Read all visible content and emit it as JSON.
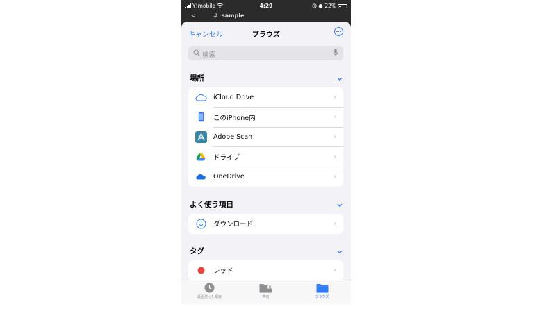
{
  "status_bar": {
    "carrier": "Y!mobile",
    "time": "4:29",
    "battery": "22%"
  },
  "behind_header": {
    "back": "<",
    "hash": "#",
    "title": "sample"
  },
  "nav": {
    "cancel_label": "キャンセル",
    "title": "ブラウズ",
    "more_icon": "ellipsis-circle-icon"
  },
  "search": {
    "placeholder": "検索"
  },
  "sections": {
    "locations": {
      "header": "場所",
      "items": [
        {
          "label": "iCloud Drive",
          "icon": "icloud-icon"
        },
        {
          "label": "このiPhone内",
          "icon": "iphone-icon"
        },
        {
          "label": "Adobe Scan",
          "icon": "adobe-scan-icon"
        },
        {
          "label": "ドライブ",
          "icon": "google-drive-icon"
        },
        {
          "label": "OneDrive",
          "icon": "onedrive-icon"
        }
      ]
    },
    "favorites": {
      "header": "よく使う項目",
      "items": [
        {
          "label": "ダウンロード",
          "icon": "download-circle-icon"
        }
      ]
    },
    "tags": {
      "header": "タグ",
      "items": [
        {
          "label": "レッド",
          "icon": "red-tag-dot-icon",
          "color": "#e8453c"
        }
      ]
    }
  },
  "tabbar": {
    "tabs": [
      {
        "label": "最近使った項目",
        "icon": "clock-icon",
        "active": false
      },
      {
        "label": "共有",
        "icon": "shared-folder-icon",
        "active": false
      },
      {
        "label": "ブラウズ",
        "icon": "folder-icon",
        "active": true
      }
    ]
  },
  "colors": {
    "accent": "#2f7cf6",
    "sheet_background": "#f2f2f7",
    "tag_red": "#e8453c"
  }
}
